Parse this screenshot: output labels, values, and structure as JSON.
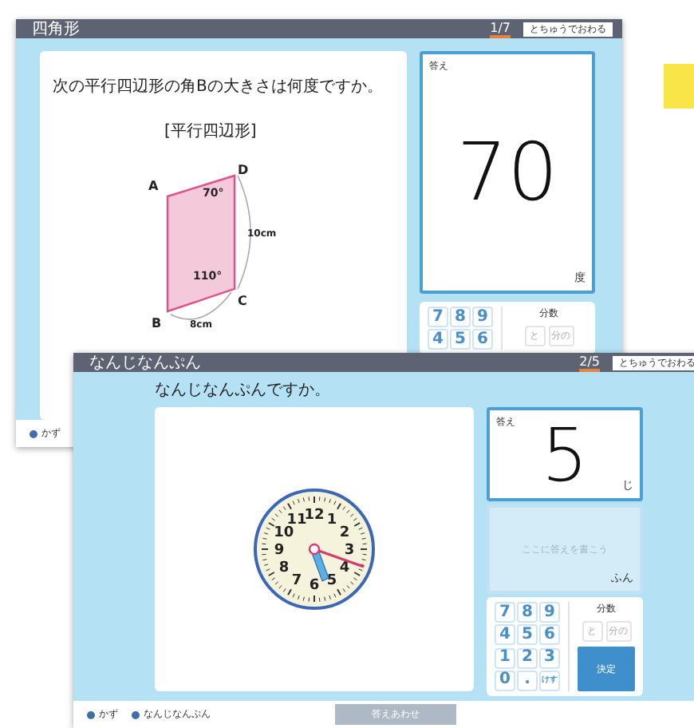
{
  "back_window": {
    "title": "四角形",
    "progress": "1/7",
    "quit_button": "とちゅうでおわる",
    "question": "次の平行四辺形の角Bの大きさは何度ですか。",
    "figure": {
      "caption": "[平行四辺形]",
      "vertex_a": "A",
      "vertex_b": "B",
      "vertex_c": "C",
      "vertex_d": "D",
      "angle_d": "70°",
      "angle_c": "110°",
      "side_cd": "10cm",
      "side_bc": "8cm"
    },
    "answer": {
      "label": "答え",
      "value": "70",
      "unit": "度"
    },
    "keypad": {
      "keys": [
        "7",
        "8",
        "9",
        "4",
        "5",
        "6"
      ],
      "fraction_label": "分数",
      "fraction_keys": [
        "と",
        "分の"
      ]
    },
    "footer": [
      "かず"
    ]
  },
  "front_window": {
    "title": "なんじなんぷん",
    "progress": "2/5",
    "quit_button": "とちゅうでおわる",
    "question": "なんじなんぷんですか。",
    "clock": {
      "numbers": [
        "12",
        "11",
        "1",
        "10",
        "2",
        "9",
        "3",
        "8",
        "4",
        "7",
        "6",
        "5"
      ]
    },
    "answers": [
      {
        "label": "答え",
        "value": "5",
        "unit": "じ"
      },
      {
        "placeholder": "ここに答えを書こう",
        "unit": "ふん"
      }
    ],
    "keypad": {
      "keys": [
        "7",
        "8",
        "9",
        "4",
        "5",
        "6",
        "1",
        "2",
        "3",
        "0",
        ".",
        "けす"
      ],
      "fraction_label": "分数",
      "fraction_keys": [
        "と",
        "分の"
      ],
      "submit": "決定"
    },
    "footer": [
      "かず",
      "なんじなんぷん"
    ],
    "check_button": {
      "label": "答えあわせ",
      "disabled": true
    }
  }
}
